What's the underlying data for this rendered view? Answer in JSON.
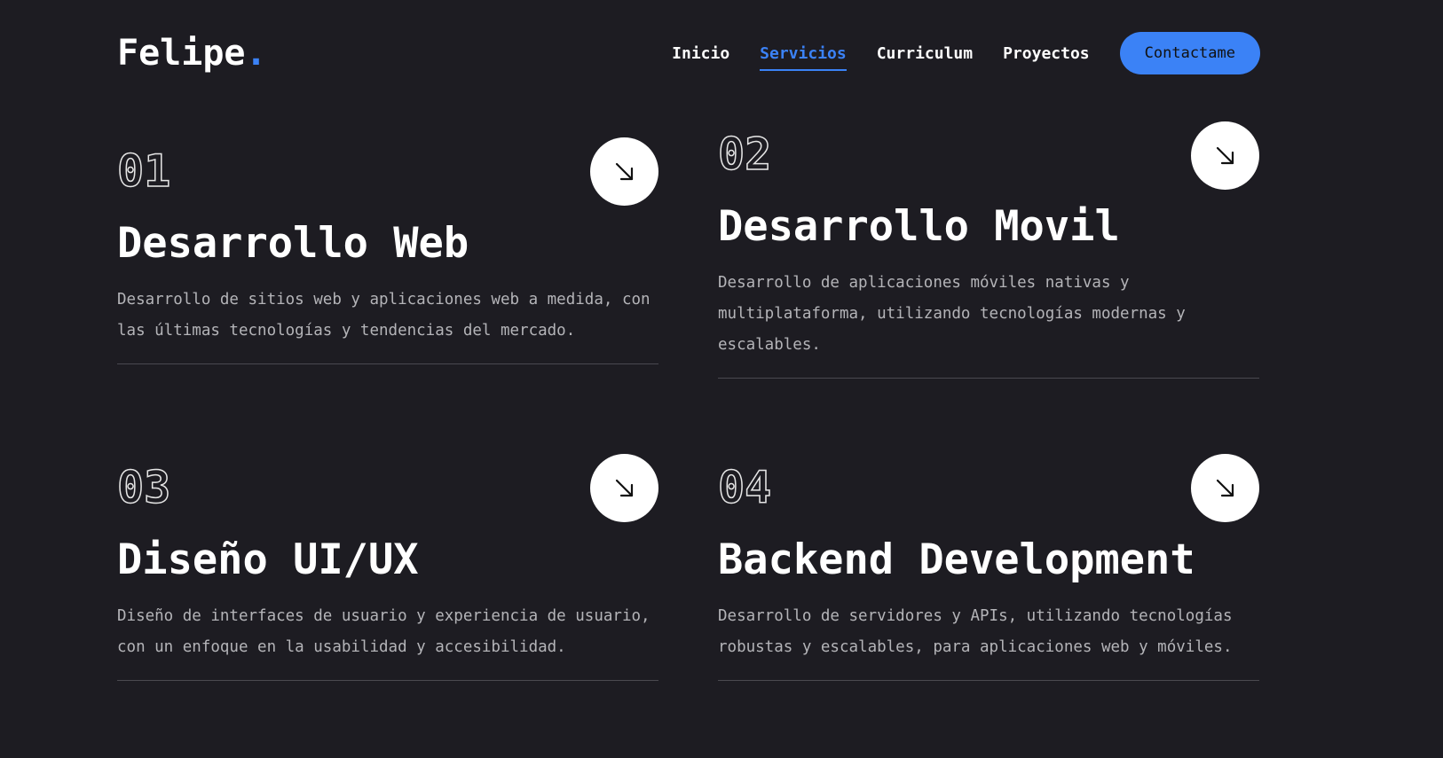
{
  "header": {
    "logo_text": "Felipe",
    "logo_dot": ".",
    "nav": [
      {
        "label": "Inicio",
        "active": false
      },
      {
        "label": "Servicios",
        "active": true
      },
      {
        "label": "Curriculum",
        "active": false
      },
      {
        "label": "Proyectos",
        "active": false
      }
    ],
    "contact_label": "Contactame"
  },
  "services": [
    {
      "number": "01",
      "title": "Desarrollo Web",
      "description": "Desarrollo de sitios web y aplicaciones web a medida, con las últimas tecnologías y tendencias del mercado."
    },
    {
      "number": "02",
      "title": "Desarrollo Movil",
      "description": "Desarrollo de aplicaciones móviles nativas y multiplataforma, utilizando tecnologías modernas y escalables."
    },
    {
      "number": "03",
      "title": "Diseño UI/UX",
      "description": "Diseño de interfaces de usuario y experiencia de usuario, con un enfoque en la usabilidad y accesibilidad."
    },
    {
      "number": "04",
      "title": "Backend Development",
      "description": "Desarrollo de servidores y APIs, utilizando tecnologías robustas y escalables, para aplicaciones web y móviles."
    }
  ],
  "icons": {
    "card_arrow": "arrow-down-right-icon"
  },
  "colors": {
    "background": "#1d1c22",
    "accent": "#3b82f6",
    "text": "#ffffff",
    "muted": "#b4b4b8"
  }
}
